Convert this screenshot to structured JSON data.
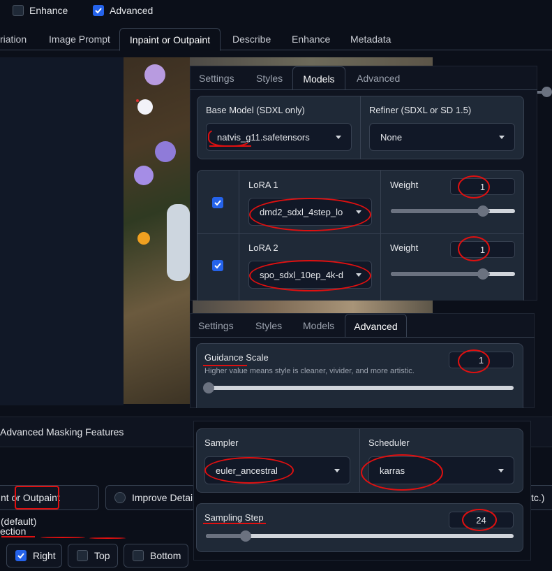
{
  "top_checkboxes": [
    {
      "label": "Enhance",
      "checked": false
    },
    {
      "label": "Advanced",
      "checked": true
    }
  ],
  "main_tabs": [
    "riation",
    "Image Prompt",
    "Inpaint or Outpaint",
    "Describe",
    "Enhance",
    "Metadata"
  ],
  "models_panel": {
    "tabs": [
      "Settings",
      "Styles",
      "Models",
      "Advanced"
    ],
    "active_tab": "Models",
    "base_model_label": "Base Model (SDXL only)",
    "base_model_value": "natvis_g11.safetensors",
    "refiner_label": "Refiner (SDXL or SD 1.5)",
    "refiner_value": "None",
    "loras": [
      {
        "label": "LoRA 1",
        "value": "dmd2_sdxl_4step_lo",
        "weight_label": "Weight",
        "weight": "1",
        "slider": 0.8,
        "checked": true
      },
      {
        "label": "LoRA 2",
        "value": "spo_sdxl_10ep_4k-d",
        "weight_label": "Weight",
        "weight": "1",
        "slider": 0.8,
        "checked": true
      }
    ]
  },
  "advanced_panel": {
    "tabs": [
      "Settings",
      "Styles",
      "Models",
      "Advanced"
    ],
    "active_tab": "Advanced",
    "guidance_label": "Guidance Scale",
    "guidance_info": "Higher value means style is cleaner, vivider, and more artistic.",
    "guidance_value": "1",
    "guidance_slider": 0.0
  },
  "sampler_panel": {
    "sampler_label": "Sampler",
    "sampler_value": "euler_ancestral",
    "scheduler_label": "Scheduler",
    "scheduler_value": "karras",
    "steps_label": "Sampling Step",
    "steps_value": "24",
    "steps_slider": 0.13
  },
  "masking_label": "Advanced Masking Features",
  "inpaint_options": {
    "left": "nt or Outpaint (default)",
    "middle": "Improve Detail",
    "right": "tc.)"
  },
  "direction_label": "ection",
  "direction_checks": [
    {
      "label": "Right",
      "checked": true
    },
    {
      "label": "Top",
      "checked": false
    },
    {
      "label": "Bottom",
      "checked": false
    }
  ],
  "colors": {
    "accent": "#2563eb",
    "annotation": "#e01010"
  }
}
